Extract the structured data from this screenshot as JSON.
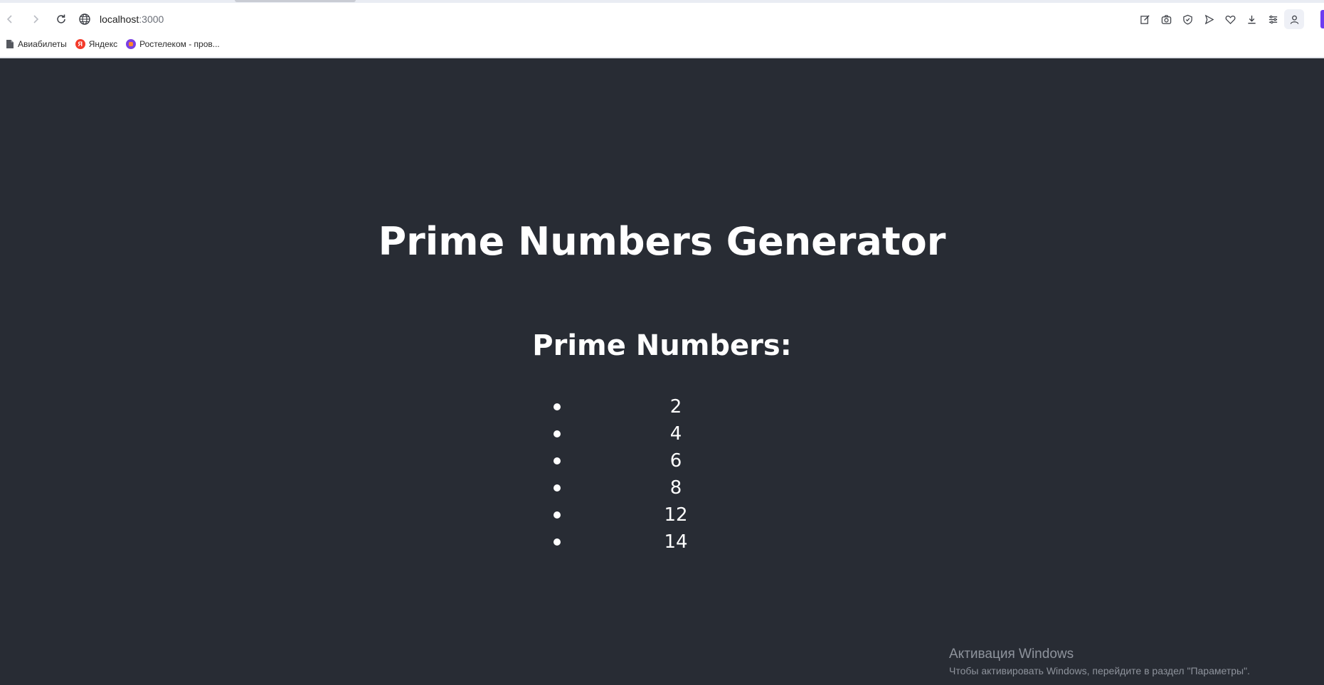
{
  "browser": {
    "url_host": "localhost",
    "url_port": ":3000",
    "nav_icons": [
      "back-icon",
      "forward-icon",
      "reload-icon"
    ],
    "site_icon": "globe-icon",
    "action_icons": [
      "edit-icon",
      "camera-icon",
      "shield-icon",
      "send-icon",
      "heart-icon",
      "download-icon",
      "menu-icon",
      "profile-icon"
    ],
    "accent_color": "#6b3cf2",
    "bookmarks": [
      {
        "label": "Авиабилеты",
        "icon": "document-icon"
      },
      {
        "label": "Яндекс",
        "icon": "yandex-icon"
      },
      {
        "label": "Ростелеком - пров...",
        "icon": "rostelecom-icon"
      }
    ]
  },
  "page": {
    "background": "#282c34",
    "title": "Prime Numbers Generator",
    "subtitle": "Prime Numbers:",
    "numbers": [
      "2",
      "4",
      "6",
      "8",
      "12",
      "14"
    ]
  },
  "windows_watermark": {
    "title": "Активация Windows",
    "text": "Чтобы активировать Windows, перейдите в раздел \"Параметры\"."
  }
}
